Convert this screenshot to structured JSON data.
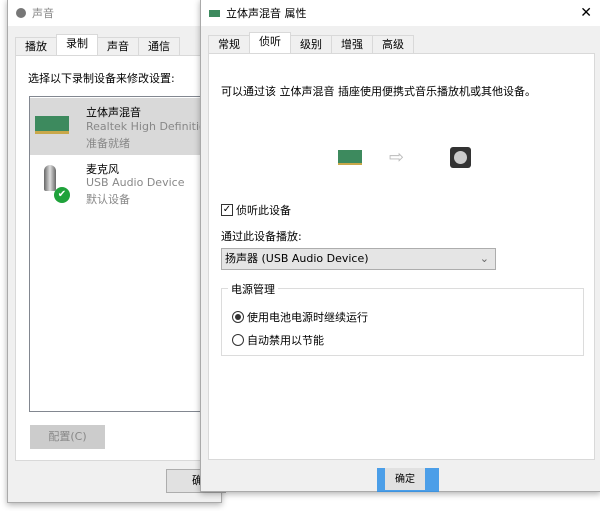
{
  "sound_window": {
    "title": "声音",
    "tabs": [
      "播放",
      "录制",
      "声音",
      "通信"
    ],
    "selected_tab": "录制",
    "instruction": "选择以下录制设备来修改设置:",
    "devices": [
      {
        "name": "立体声混音",
        "driver": "Realtek High Definition",
        "status": "准备就绪",
        "icon": "sound-card-icon"
      },
      {
        "name": "麦克风",
        "driver": "USB Audio Device",
        "status": "默认设备",
        "icon": "microphone-icon"
      }
    ],
    "configure_button": "配置(C)",
    "ok_button_partial": "确"
  },
  "props_window": {
    "title": "立体声混音 属性",
    "close": "✕",
    "tabs": [
      "常规",
      "侦听",
      "级别",
      "增强",
      "高级"
    ],
    "selected_tab": "侦听",
    "description": "可以通过该 立体声混音 插座使用便携式音乐播放机或其他设备。",
    "listen_checkbox": {
      "label": "侦听此设备",
      "checked": true
    },
    "playback_label": "通过此设备播放:",
    "playback_select": "扬声器 (USB Audio Device)",
    "power_group": {
      "title": "电源管理",
      "options": [
        {
          "label": "使用电池电源时继续运行",
          "selected": true
        },
        {
          "label": "自动禁用以节能",
          "selected": false
        }
      ]
    },
    "ok_button": "确定"
  }
}
